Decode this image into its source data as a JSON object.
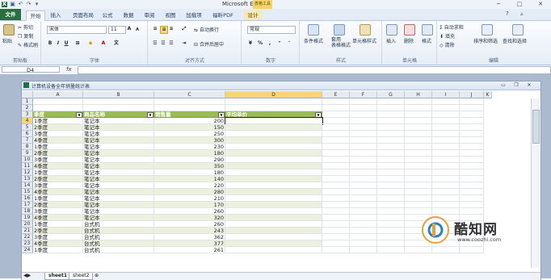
{
  "titlebar": {
    "title": "Microsoft Excel",
    "context_tab_group": "表格工具",
    "qat_icons": [
      "excel-logo-icon",
      "save-icon",
      "undo-icon",
      "redo-icon",
      "customize-qat-icon"
    ]
  },
  "tabs": [
    "文件",
    "开始",
    "插入",
    "页面布局",
    "公式",
    "数据",
    "审阅",
    "视图",
    "加载项",
    "福昕PDF",
    "设计"
  ],
  "ribbon": {
    "clipboard": {
      "label": "剪贴板",
      "paste": "粘贴",
      "cut": "剪切",
      "copy": "复制",
      "format_painter": "格式刷"
    },
    "font": {
      "label": "字体",
      "font_name": "宋体",
      "font_size": "11",
      "bold": "B",
      "italic": "I",
      "underline": "U",
      "grow": "A",
      "shrink": "A"
    },
    "alignment": {
      "label": "对齐方式",
      "wrap": "自动换行",
      "merge": "合并后居中"
    },
    "number": {
      "label": "数字",
      "format": "常规",
      "percent": "%",
      "comma": ","
    },
    "styles": {
      "label": "样式",
      "conditional": "条件格式",
      "table": "套用\n表格格式",
      "cell_styles": "单元格样式"
    },
    "cells": {
      "label": "单元格",
      "insert": "插入",
      "delete": "删除",
      "format": "格式"
    },
    "editing": {
      "label": "编辑",
      "autosum": "自动求和",
      "fill": "填充",
      "clear": "清除",
      "sort": "排序和筛选",
      "find": "查找和选择"
    }
  },
  "formula_bar": {
    "name_box": "D4",
    "fx": "fx",
    "formula": ""
  },
  "document": {
    "title": "计算机设备全年销量统计表",
    "columns": [
      "A",
      "B",
      "C",
      "D",
      "E",
      "F",
      "G",
      "H",
      "I",
      "J",
      "K"
    ],
    "row_numbers": [
      "1",
      "2",
      "3",
      "4",
      "5",
      "6",
      "7",
      "8",
      "9",
      "10",
      "11",
      "12",
      "13",
      "14",
      "15",
      "16",
      "17",
      "18",
      "19",
      "20",
      "21",
      "22",
      "23",
      "24"
    ],
    "table_headers": [
      "季度",
      "商品名称",
      "销售量",
      "平均单价"
    ],
    "rows": [
      [
        "1季度",
        "笔记本",
        "200"
      ],
      [
        "2季度",
        "笔记本",
        "150"
      ],
      [
        "3季度",
        "笔记本",
        "250"
      ],
      [
        "4季度",
        "笔记本",
        "300"
      ],
      [
        "1季度",
        "笔记本",
        "230"
      ],
      [
        "2季度",
        "笔记本",
        "180"
      ],
      [
        "3季度",
        "笔记本",
        "290"
      ],
      [
        "4季度",
        "笔记本",
        "350"
      ],
      [
        "1季度",
        "笔记本",
        "180"
      ],
      [
        "2季度",
        "笔记本",
        "140"
      ],
      [
        "3季度",
        "笔记本",
        "220"
      ],
      [
        "4季度",
        "笔记本",
        "280"
      ],
      [
        "1季度",
        "笔记本",
        "210"
      ],
      [
        "2季度",
        "笔记本",
        "170"
      ],
      [
        "3季度",
        "笔记本",
        "260"
      ],
      [
        "4季度",
        "笔记本",
        "320"
      ],
      [
        "1季度",
        "台式机",
        "260"
      ],
      [
        "2季度",
        "台式机",
        "243"
      ],
      [
        "3季度",
        "台式机",
        "362"
      ],
      [
        "4季度",
        "台式机",
        "377"
      ],
      [
        "1季度",
        "台式机",
        "261"
      ]
    ],
    "sheet_tabs": [
      "sheet1",
      "sheet2"
    ]
  },
  "watermark": {
    "name": "酷知网",
    "url": "www.coozhi.com"
  }
}
